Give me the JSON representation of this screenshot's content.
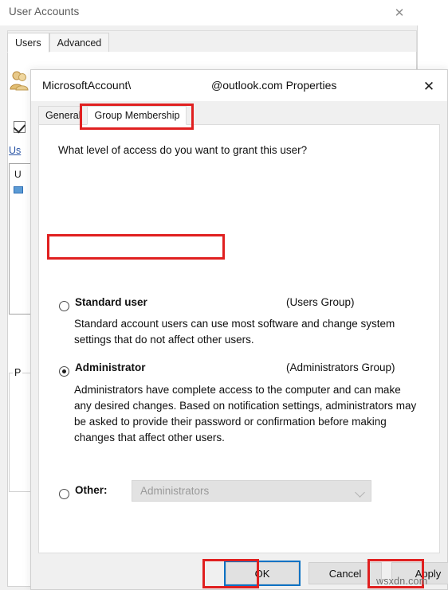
{
  "outer_window": {
    "title": "User Accounts",
    "close_icon": "close-icon",
    "close_glyph": "✕",
    "tabs": [
      {
        "label": "Users",
        "selected": true
      },
      {
        "label": "Advanced",
        "selected": false
      }
    ],
    "background_widgets": {
      "checkbox_checked": true,
      "link_text": "Us",
      "list_header": "U",
      "group_label": "P",
      "user_icon": "users-icon"
    }
  },
  "dialog": {
    "title_left": "MicrosoftAccount\\",
    "title_right": "@outlook.com Properties",
    "close_icon": "close-icon",
    "close_glyph": "✕",
    "tabs": [
      {
        "label": "General",
        "selected": false
      },
      {
        "label": "Group Membership",
        "selected": true
      }
    ],
    "question": "What level of access do you want to grant this user?",
    "options": [
      {
        "id": "standard-user",
        "title": "Standard user",
        "group": "(Users Group)",
        "description": "Standard account users can use most software and change system settings that do not affect other users.",
        "selected": false
      },
      {
        "id": "administrator",
        "title": "Administrator",
        "group": "(Administrators Group)",
        "description": "Administrators have complete access to the computer and can make any desired changes. Based on notification settings, administrators may be asked to provide their password or confirmation before making changes that affect other users.",
        "selected": true
      },
      {
        "id": "other",
        "title": "Other:",
        "group": "",
        "description": "",
        "selected": false
      }
    ],
    "other_combo": {
      "value": "Administrators",
      "disabled": true,
      "arrow_icon": "chevron-down-icon"
    },
    "buttons": [
      {
        "id": "ok",
        "label": "OK",
        "focused": true,
        "highlighted": true
      },
      {
        "id": "cancel",
        "label": "Cancel",
        "focused": false,
        "highlighted": false
      },
      {
        "id": "apply",
        "label": "Apply",
        "focused": false,
        "highlighted": true
      }
    ]
  },
  "annotations": {
    "accent_red": "#e02020",
    "focus_blue": "#0b72c4",
    "highlighted_targets": [
      "Group Membership",
      "Administrator",
      "OK",
      "Apply"
    ]
  },
  "watermark": {
    "text": "wsxdn.com"
  }
}
